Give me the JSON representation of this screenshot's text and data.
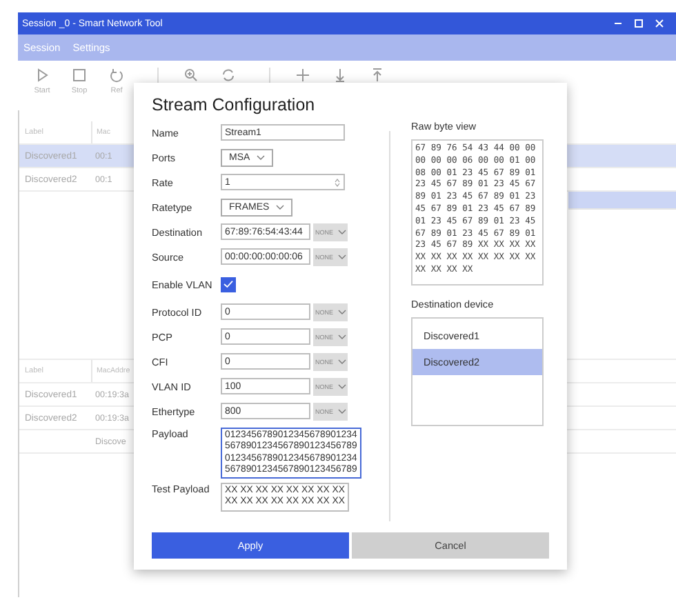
{
  "window": {
    "title": "Session _0 - Smart Network Tool"
  },
  "menu": [
    "Session",
    "Settings"
  ],
  "toolbar": [
    {
      "kind": "play",
      "label": "Start"
    },
    {
      "kind": "stop",
      "label": "Stop"
    },
    {
      "kind": "refresh",
      "label": "Ref"
    },
    {
      "kind": "separator"
    },
    {
      "kind": "zoom"
    },
    {
      "kind": "sync"
    },
    {
      "kind": "separator"
    },
    {
      "kind": "add"
    },
    {
      "kind": "download"
    },
    {
      "kind": "upload"
    }
  ],
  "device_table": {
    "columns": [
      "Label",
      "Mac"
    ],
    "rows": [
      {
        "label": "Discovered1",
        "mac": "00:1",
        "selected": true
      },
      {
        "label": "Discovered2",
        "mac": "00:1",
        "selected": false
      }
    ]
  },
  "device_list": {
    "rows": [
      {
        "selected": true
      }
    ]
  },
  "stream_table": {
    "columns": [
      "Label",
      "MacAddre"
    ],
    "rows": [
      {
        "label": "Discovered1",
        "mac": "00:19:3a"
      },
      {
        "label": "Discovered2",
        "mac": "00:19:3a"
      },
      {
        "mac": "Discove"
      }
    ]
  },
  "dialog": {
    "title": "Stream Configuration",
    "fields": [
      {
        "kind": "text",
        "label": "Name",
        "value": "Stream1"
      },
      {
        "kind": "select",
        "label": "Ports",
        "value": "MSA"
      },
      {
        "kind": "spin",
        "label": "Rate",
        "value": "1"
      },
      {
        "kind": "select",
        "label": "Ratetype",
        "value": "FRAMES"
      },
      {
        "kind": "masked",
        "label": "Destination",
        "value": "67:89:76:54:43:44",
        "mask": "NONE"
      },
      {
        "kind": "masked",
        "label": "Source",
        "value": "00:00:00:00:00:06",
        "mask": "NONE"
      },
      {
        "kind": "checkbox",
        "label": "Enable VLAN",
        "checked": true
      },
      {
        "kind": "masked",
        "label": "Protocol ID",
        "value": "0",
        "mask": "NONE"
      },
      {
        "kind": "masked",
        "label": "PCP",
        "value": "0",
        "mask": "NONE"
      },
      {
        "kind": "masked",
        "label": "CFI",
        "value": "0",
        "mask": "NONE"
      },
      {
        "kind": "masked",
        "label": "VLAN ID",
        "value": "100",
        "mask": "NONE"
      },
      {
        "kind": "masked",
        "label": "Ethertype",
        "value": "800",
        "mask": "NONE"
      },
      {
        "kind": "area",
        "label": "Payload",
        "focused": true,
        "lines": [
          "0123456789012345678901234",
          "5678901234567890123456789",
          "0123456789012345678901234",
          "5678901234567890123456789"
        ]
      },
      {
        "kind": "area",
        "label": "Test Payload",
        "focused": false,
        "lines": [
          "XX XX XX XX XX XX XX XX",
          "XX XX XX XX XX XX XX XX"
        ]
      }
    ],
    "raw_bytes": {
      "label": "Raw byte view",
      "lines": [
        "67 89 76 54 43 44 00 00",
        "00 00 00 06 00 00 01 00",
        "08 00 01 23 45 67 89 01",
        "23 45 67 89 01 23 45 67",
        "89 01 23 45 67 89 01 23",
        "45 67 89 01 23 45 67 89",
        "01 23 45 67 89 01 23 45",
        "67 89 01 23 45 67 89 01",
        "23 45 67 89 XX XX XX XX",
        "XX XX XX XX XX XX XX XX",
        "XX XX XX XX"
      ]
    },
    "destination": {
      "label": "Destination device",
      "items": [
        {
          "label": "Discovered1",
          "selected": false
        },
        {
          "label": "Discovered2",
          "selected": true
        }
      ]
    },
    "buttons": [
      {
        "kind": "primary",
        "label": "Apply"
      },
      {
        "kind": "secondary",
        "label": "Cancel"
      }
    ]
  }
}
